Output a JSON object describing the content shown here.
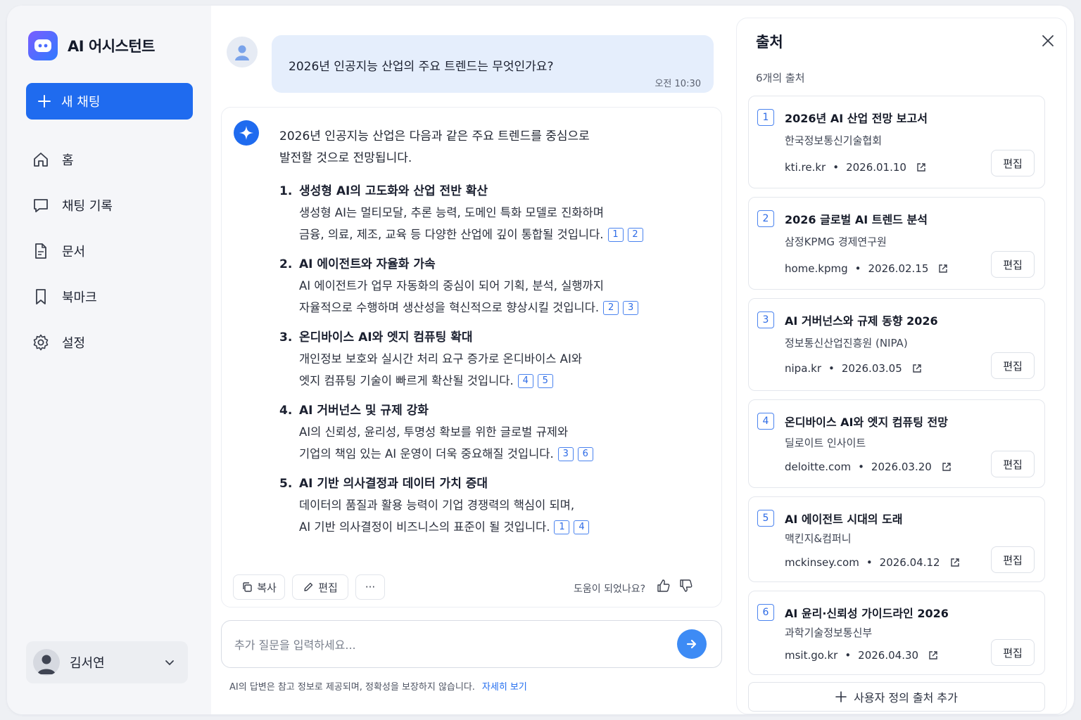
{
  "app": {
    "title": "AI 어시스턴트"
  },
  "sidebar": {
    "new_chat_label": "새 채팅",
    "items": [
      {
        "label": "홈",
        "icon": "home-icon"
      },
      {
        "label": "채팅 기록",
        "icon": "chat-icon"
      },
      {
        "label": "문서",
        "icon": "document-icon"
      },
      {
        "label": "북마크",
        "icon": "bookmark-icon"
      },
      {
        "label": "설정",
        "icon": "gear-icon"
      }
    ],
    "user": {
      "name": "김서연"
    }
  },
  "chat": {
    "user_message": {
      "text": "2026년 인공지능 산업의 주요 트렌드는 무엇인가요?",
      "time": "오전 10:30"
    },
    "answer": {
      "intro_line1": "2026년 인공지능 산업은 다음과 같은 주요 트렌드를 중심으로",
      "intro_line2": "발전할 것으로 전망됩니다.",
      "items": [
        {
          "num": "1.",
          "title": "생성형 AI의 고도화와 산업 전반 확산",
          "line1": "생성형 AI는 멀티모달, 추론 능력, 도메인 특화 모델로 진화하며",
          "line2": "금융, 의료, 제조, 교육 등 다양한 산업에 깊이 통합될 것입니다.",
          "cites": [
            "1",
            "2"
          ]
        },
        {
          "num": "2.",
          "title": "AI 에이전트와 자율화 가속",
          "line1": "AI 에이전트가 업무 자동화의 중심이 되어 기획, 분석, 실행까지",
          "line2": "자율적으로 수행하며 생산성을 혁신적으로 향상시킬 것입니다.",
          "cites": [
            "2",
            "3"
          ]
        },
        {
          "num": "3.",
          "title": "온디바이스 AI와 엣지 컴퓨팅 확대",
          "line1": "개인정보 보호와 실시간 처리 요구 증가로 온디바이스 AI와",
          "line2": "엣지 컴퓨팅 기술이 빠르게 확산될 것입니다.",
          "cites": [
            "4",
            "5"
          ]
        },
        {
          "num": "4.",
          "title": "AI 거버넌스 및 규제 강화",
          "line1": "AI의 신뢰성, 윤리성, 투명성 확보를 위한 글로벌 규제와",
          "line2": "기업의 책임 있는 AI 운영이 더욱 중요해질 것입니다.",
          "cites": [
            "3",
            "6"
          ]
        },
        {
          "num": "5.",
          "title": "AI 기반 의사결정과 데이터 가치 증대",
          "line1": "데이터의 품질과 활용 능력이 기업 경쟁력의 핵심이 되며,",
          "line2": "AI 기반 의사결정이 비즈니스의 표준이 될 것입니다.",
          "cites": [
            "1",
            "4"
          ]
        }
      ]
    },
    "actions": {
      "copy": "복사",
      "edit": "편집",
      "more": "···",
      "helpful": "도움이 되었나요?"
    },
    "input": {
      "placeholder": "추가 질문을 입력하세요..."
    },
    "disclaimer": {
      "text": "AI의 답변은 참고 정보로 제공되며, 정확성을 보장하지 않습니다.",
      "link": "자세히 보기"
    }
  },
  "sources": {
    "title": "출처",
    "count": "6개의 출처",
    "edit_label": "편집",
    "items": [
      {
        "num": "1",
        "title": "2026년 AI 산업 전망 보고서",
        "org": "한국정보통신기술협회",
        "domain": "kti.re.kr",
        "date": "2026.01.10"
      },
      {
        "num": "2",
        "title": "2026 글로벌 AI 트렌드 분석",
        "org": "삼정KPMG 경제연구원",
        "domain": "home.kpmg",
        "date": "2026.02.15"
      },
      {
        "num": "3",
        "title": "AI 거버넌스와 규제 동향 2026",
        "org": "정보통신산업진흥원 (NIPA)",
        "domain": "nipa.kr",
        "date": "2026.03.05"
      },
      {
        "num": "4",
        "title": "온디바이스 AI와 엣지 컴퓨팅 전망",
        "org": "딜로이트 인사이트",
        "domain": "deloitte.com",
        "date": "2026.03.20"
      },
      {
        "num": "5",
        "title": "AI 에이전트 시대의 도래",
        "org": "맥킨지&컴퍼니",
        "domain": "mckinsey.com",
        "date": "2026.04.12"
      },
      {
        "num": "6",
        "title": "AI 윤리·신뢰성 가이드라인 2026",
        "org": "과학기술정보통신부",
        "domain": "msit.go.kr",
        "date": "2026.04.30"
      }
    ],
    "add_label": "사용자 정의 출처 추가"
  },
  "colors": {
    "accent": "#1f6bef",
    "user_bubble": "#e5eefc",
    "sidebar_bg": "#f5f6f9"
  }
}
